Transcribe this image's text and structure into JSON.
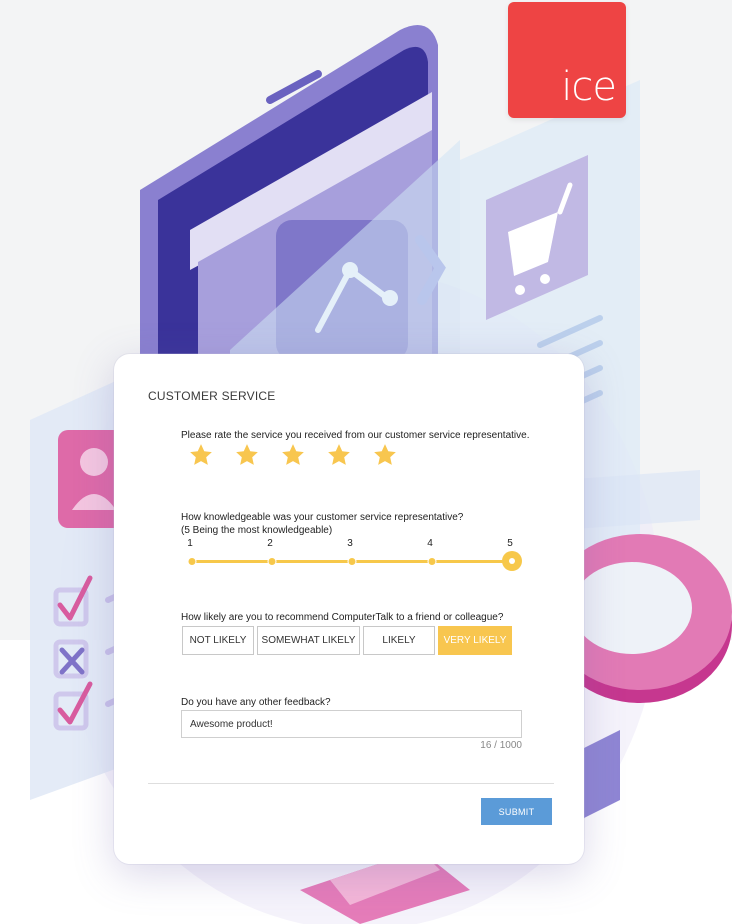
{
  "brand": {
    "logo_text": "ice",
    "color": "#ee4444"
  },
  "survey": {
    "title": "CUSTOMER SERVICE",
    "rating": {
      "question": "Please rate the service you received from our customer service representative.",
      "stars_total": 5,
      "stars_selected": 5,
      "star_color": "#f8c64f"
    },
    "knowledge": {
      "question": "How knowledgeable was your customer service representative?",
      "hint": "(5 Being the most knowledgeable)",
      "scale": [
        "1",
        "2",
        "3",
        "4",
        "5"
      ],
      "selected_value": 5,
      "accent": "#f7c84a"
    },
    "recommend": {
      "question": "How likely are you to recommend ComputerTalk to a friend or colleague?",
      "options": [
        "NOT LIKELY",
        "SOMEWHAT LIKELY",
        "LIKELY",
        "VERY LIKELY"
      ],
      "selected": "VERY LIKELY"
    },
    "feedback": {
      "question": "Do you have any other feedback?",
      "value": "Awesome product!",
      "counter": "16 / 1000"
    },
    "submit_label": "SUBMIT",
    "submit_color": "#5b9bd8"
  }
}
